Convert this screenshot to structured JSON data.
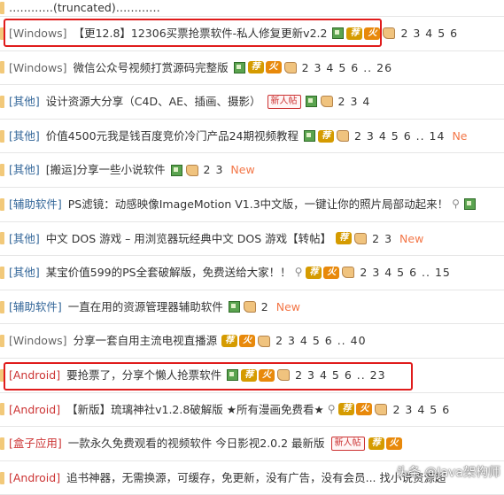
{
  "rows": [
    {
      "cat": "",
      "title": "…………(truncated)…………",
      "pages": "",
      "new": ""
    },
    {
      "cat": "[Windows]",
      "title": "【更12.8】12306买票抢票软件-私人修复更新v2.2",
      "pages": "2 3 4 5 6",
      "new": ""
    },
    {
      "cat": "[Windows]",
      "title": "微信公众号视频打赏源码完整版",
      "pages": "2 3 4 5 6 .. 26",
      "new": ""
    },
    {
      "cat": "[其他]",
      "title": "设计资源大分享（C4D、AE、插画、摄影）",
      "newpost": "新人帖",
      "pages": "2 3 4",
      "new": ""
    },
    {
      "cat": "[其他]",
      "title": "价值4500元我是钱百度竞价冷门产品24期视频教程",
      "pages": "2 3 4 5 6 .. 14",
      "new": "Ne"
    },
    {
      "cat": "[其他]",
      "title": "[搬运]分享一些小说软件",
      "pages": "2 3",
      "new": "New"
    },
    {
      "cat": "[辅助软件]",
      "title": "PS滤镜：动感映像ImageMotion V1.3中文版，一键让你的照片局部动起来！",
      "pages": "",
      "new": ""
    },
    {
      "cat": "[其他]",
      "title": "中文 DOS 游戏 – 用浏览器玩经典中文 DOS 游戏【转帖】",
      "pages": "2 3",
      "new": "New"
    },
    {
      "cat": "[其他]",
      "title": "某宝价值599的PS全套破解版，免费送给大家！！",
      "pages": "2 3 4 5 6 .. 15",
      "new": ""
    },
    {
      "cat": "[辅助软件]",
      "title": "一直在用的资源管理器辅助软件",
      "pages": "2",
      "new": "New"
    },
    {
      "cat": "[Windows]",
      "title": "分享一套自用主流电视直播源",
      "pages": "2 3 4 5 6 .. 40",
      "new": ""
    },
    {
      "cat": "[Android]",
      "title": "要抢票了，分享个懒人抢票软件",
      "pages": "2 3 4 5 6 .. 23",
      "new": ""
    },
    {
      "cat": "[Android]",
      "title": "【新版】琉璃神社v1.2.8破解版 ★所有漫画免费看★",
      "pages": "2 3 4 5 6",
      "new": ""
    },
    {
      "cat": "[盒子应用]",
      "title": "一款永久免费观看的视频软件 今日影视2.0.2 最新版",
      "newpost": "新人帖",
      "pages": "",
      "new": ""
    },
    {
      "cat": "[Android]",
      "title": "追书神器，无需换源，可缓存，免更新，没有广告，没有会员... 找小说资源超",
      "pages": "",
      "new": ""
    }
  ],
  "icons": {
    "image": "image-icon",
    "recommend": "荐",
    "hot": "火",
    "thumb": "thumb-icon",
    "attach": "attachment-icon"
  },
  "colors": {
    "highlight": "#e01c1c",
    "category_blue": "#336699",
    "category_red": "#cc3333",
    "new": "#f37748"
  },
  "watermark": "头条 @Java架构师"
}
